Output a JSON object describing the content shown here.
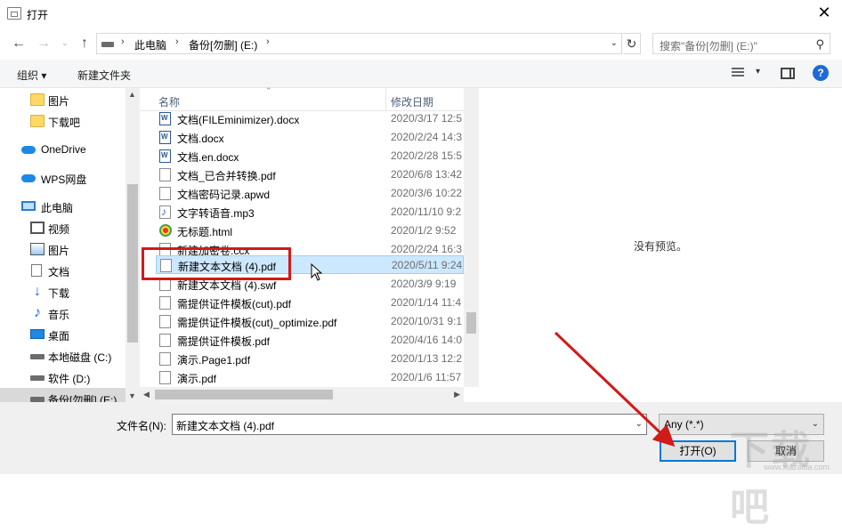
{
  "window": {
    "title": "打开",
    "close_glyph": "✕"
  },
  "address": {
    "crumbs": [
      "此电脑",
      "备份[勿删] (E:)"
    ],
    "search_placeholder": "搜索\"备份[勿删] (E:)\""
  },
  "toolbar": {
    "organize": "组织 ▾",
    "new_folder": "新建文件夹",
    "help": "?"
  },
  "sidebar": {
    "items": [
      {
        "label": "图片",
        "icon": "folder-icon"
      },
      {
        "label": "下载吧",
        "icon": "folder-icon"
      },
      {
        "label": "OneDrive",
        "icon": "cloud-icon"
      },
      {
        "label": "WPS网盘",
        "icon": "cloud-icon"
      },
      {
        "label": "此电脑",
        "icon": "computer-icon"
      },
      {
        "label": "视频",
        "icon": "video-icon"
      },
      {
        "label": "图片",
        "icon": "pictures-icon"
      },
      {
        "label": "文档",
        "icon": "document-icon"
      },
      {
        "label": "下载",
        "icon": "download-icon"
      },
      {
        "label": "音乐",
        "icon": "music-icon"
      },
      {
        "label": "桌面",
        "icon": "desktop-icon"
      },
      {
        "label": "本地磁盘 (C:)",
        "icon": "drive-icon"
      },
      {
        "label": "软件 (D:)",
        "icon": "drive-icon"
      },
      {
        "label": "备份[勿删] (E:)",
        "icon": "drive-icon"
      }
    ]
  },
  "filelist": {
    "columns": [
      "名称",
      "修改日期"
    ],
    "rows": [
      {
        "name": "文档(FILEminimizer).docx",
        "date": "2020/3/17 12:5",
        "type": "word"
      },
      {
        "name": "文档.docx",
        "date": "2020/2/24 14:3",
        "type": "word"
      },
      {
        "name": "文档.en.docx",
        "date": "2020/2/28 15:5",
        "type": "word"
      },
      {
        "name": "文档_已合并转换.pdf",
        "date": "2020/6/8 13:42",
        "type": "file"
      },
      {
        "name": "文档密码记录.apwd",
        "date": "2020/3/6 10:22",
        "type": "file"
      },
      {
        "name": "文字转语音.mp3",
        "date": "2020/11/10 9:2",
        "type": "audio"
      },
      {
        "name": "无标题.html",
        "date": "2020/1/2 9:52",
        "type": "html"
      },
      {
        "name": "新建加密卷.ccx",
        "date": "2020/2/24 16:3",
        "type": "file"
      },
      {
        "name": "新建文本文档 (4).pdf",
        "date": "2020/5/11 9:24",
        "type": "file"
      },
      {
        "name": "新建文本文档 (4).swf",
        "date": "2020/3/9 9:19",
        "type": "file"
      },
      {
        "name": "需提供证件模板(cut).pdf",
        "date": "2020/1/14 11:4",
        "type": "file"
      },
      {
        "name": "需提供证件模板(cut)_optimize.pdf",
        "date": "2020/10/31 9:1",
        "type": "file"
      },
      {
        "name": "需提供证件模板.pdf",
        "date": "2020/4/16 14:0",
        "type": "file"
      },
      {
        "name": "演示.Page1.pdf",
        "date": "2020/1/13 12:2",
        "type": "file"
      },
      {
        "name": "演示.pdf",
        "date": "2020/1/6 11:57",
        "type": "file"
      }
    ],
    "selected_index": 8
  },
  "preview": {
    "message": "没有预览。"
  },
  "bottom": {
    "filename_label": "文件名(N):",
    "filename_value": "新建文本文档 (4).pdf",
    "filter_value": "Any (*.*)",
    "open_label": "打开(O)",
    "cancel_label": "取消"
  },
  "watermark": {
    "text": "下载吧",
    "sub": "www.xiazaiba.com"
  },
  "colors": {
    "highlight": "#d11a1a",
    "selection": "#cce8ff",
    "accent": "#0078d7"
  }
}
